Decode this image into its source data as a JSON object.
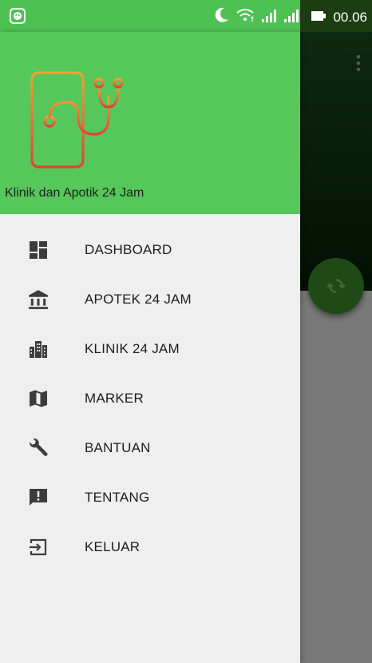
{
  "status_bar": {
    "time": "00.06",
    "icons": [
      "download-notification-icon",
      "moon-icon",
      "wifi-icon",
      "signal-icon",
      "signal-icon",
      "battery-icon"
    ]
  },
  "drawer": {
    "app_name": "Klinik dan Apotik 24 Jam",
    "logo_icon": "phone-stethoscope-icon",
    "items": [
      {
        "label": "DASHBOARD",
        "icon": "dashboard-icon"
      },
      {
        "label": "APOTEK 24 JAM",
        "icon": "bank-icon"
      },
      {
        "label": "KLINIK 24 JAM",
        "icon": "city-buildings-icon"
      },
      {
        "label": "MARKER",
        "icon": "map-icon"
      },
      {
        "label": "BANTUAN",
        "icon": "wrench-icon"
      },
      {
        "label": "TENTANG",
        "icon": "feedback-icon"
      },
      {
        "label": "KELUAR",
        "icon": "exit-icon"
      }
    ]
  },
  "colors": {
    "header_green": "#56c75a",
    "drawer_bg": "#efefef",
    "fab": "#1f4a16",
    "icon": "#3c3c3c"
  }
}
